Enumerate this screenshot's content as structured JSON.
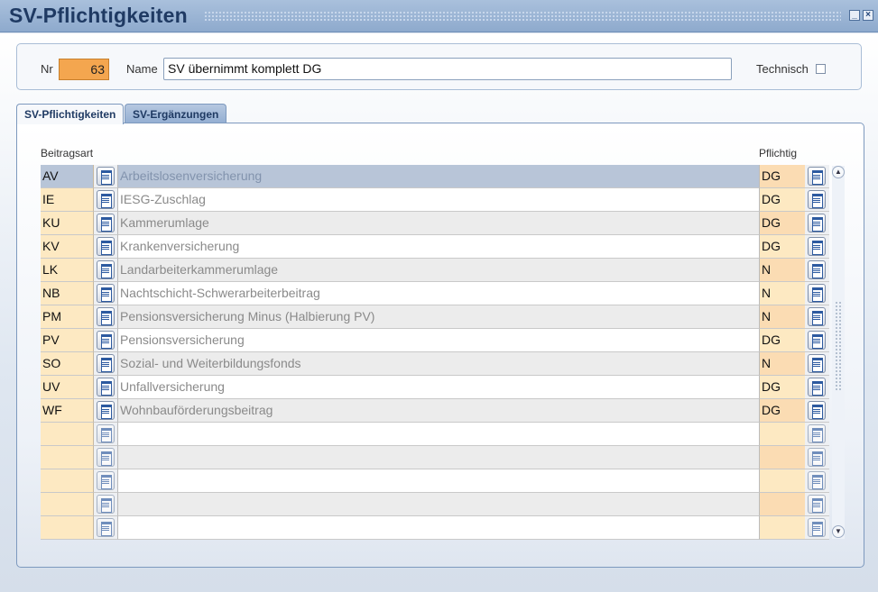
{
  "window": {
    "title": "SV-Pflichtigkeiten",
    "minimize_glyph": "_",
    "close_glyph": "×"
  },
  "header": {
    "nr_label": "Nr",
    "nr_value": "63",
    "name_label": "Name",
    "name_value": "SV übernimmt komplett DG",
    "technisch_label": "Technisch",
    "technisch_checked": false,
    "nr_color": "#f4a64f"
  },
  "tabs": [
    {
      "label": "SV-Pflichtigkeiten",
      "active": true
    },
    {
      "label": "SV-Ergänzungen",
      "active": false
    }
  ],
  "grid": {
    "col_beitragsart": "Beitragsart",
    "col_pflichtig": "Pflichtig",
    "rows": [
      {
        "code": "AV",
        "name": "Arbeitslosenversicherung",
        "pflichtig": "DG"
      },
      {
        "code": "IE",
        "name": "IESG-Zuschlag",
        "pflichtig": "DG"
      },
      {
        "code": "KU",
        "name": "Kammerumlage",
        "pflichtig": "DG"
      },
      {
        "code": "KV",
        "name": "Krankenversicherung",
        "pflichtig": "DG"
      },
      {
        "code": "LK",
        "name": "Landarbeiterkammerumlage",
        "pflichtig": "N"
      },
      {
        "code": "NB",
        "name": "Nachtschicht-Schwerarbeiterbeitrag",
        "pflichtig": "N"
      },
      {
        "code": "PM",
        "name": "Pensionsversicherung Minus (Halbierung PV)",
        "pflichtig": "N"
      },
      {
        "code": "PV",
        "name": "Pensionsversicherung",
        "pflichtig": "DG"
      },
      {
        "code": "SO",
        "name": "Sozial- und Weiterbildungsfonds",
        "pflichtig": "N"
      },
      {
        "code": "UV",
        "name": "Unfallversicherung",
        "pflichtig": "DG"
      },
      {
        "code": "WF",
        "name": "Wohnbauförderungsbeitrag",
        "pflichtig": "DG"
      },
      {
        "code": "",
        "name": "",
        "pflichtig": ""
      },
      {
        "code": "",
        "name": "",
        "pflichtig": ""
      },
      {
        "code": "",
        "name": "",
        "pflichtig": ""
      },
      {
        "code": "",
        "name": "",
        "pflichtig": ""
      },
      {
        "code": "",
        "name": "",
        "pflichtig": ""
      }
    ],
    "selected_row": 0
  },
  "scrollbar": {
    "up_glyph": "▲",
    "down_glyph": "▼"
  }
}
